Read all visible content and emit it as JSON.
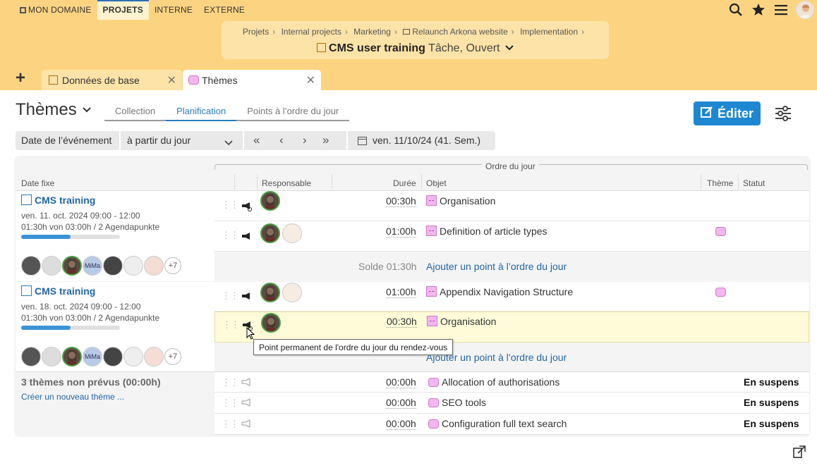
{
  "topnav": {
    "items": [
      "MON DOMAINE",
      "PROJETS",
      "INTERNE",
      "EXTERNE"
    ],
    "active_index": 1
  },
  "breadcrumb": {
    "items": [
      "Projets",
      "Internal projects",
      "Marketing",
      "Relaunch Arkona website",
      "Implementation"
    ],
    "title": "CMS user training",
    "subtitle": "Tâche, Ouvert"
  },
  "tabs": {
    "items": [
      "Données de base",
      "Thèmes"
    ],
    "active_index": 1
  },
  "section": {
    "title": "Thèmes",
    "subtabs": [
      "Collection",
      "Planification",
      "Points à l’ordre du jour"
    ],
    "active_subtab": 1,
    "edit_label": "Éditer"
  },
  "filter": {
    "date_label": "Date de l’événement",
    "range_value": "à partir du jour",
    "date_value": "ven. 11/10/24 (41. Sem.)"
  },
  "table": {
    "group_header": "Ordre du jour",
    "columns": {
      "date": "Date fixe",
      "responsible": "Responsable",
      "duration": "Durée",
      "object": "Objet",
      "theme": "Thème",
      "status": "Statut"
    },
    "meetings": [
      {
        "title": "CMS training",
        "datetime": "ven. 11. oct. 2024 09:00 - 12:00",
        "summary": "01:30h von 03:00h / 2 Agendapunkte",
        "progress": 0.5,
        "participants_more": "+7",
        "balance": "Solde 01:30h",
        "add_link": "Ajouter un point à l’ordre du jour",
        "items": [
          {
            "duration": "00:30h",
            "object": "Organisation",
            "theme": false
          },
          {
            "duration": "01:00h",
            "object": "Definition of article types",
            "theme": true
          }
        ]
      },
      {
        "title": "CMS training",
        "datetime": "ven. 18. oct. 2024 09:00 - 12:00",
        "summary": "01:30h von 03:00h / 2 Agendapunkte",
        "progress": 0.5,
        "participants_more": "+7",
        "add_link": "Ajouter un point à l’ordre du jour",
        "items": [
          {
            "duration": "01:00h",
            "object": "Appendix Navigation Structure",
            "theme": true
          },
          {
            "duration": "00:30h",
            "object": "Organisation",
            "theme": false
          }
        ]
      }
    ],
    "unplanned": {
      "title": "3 thèmes non prévus (00:00h)",
      "create_link": "Créer un nouveau thème ...",
      "items": [
        {
          "duration": "00:00h",
          "object": "Allocation of authorisations",
          "status": "En suspens"
        },
        {
          "duration": "00:00h",
          "object": "SEO tools",
          "status": "En suspens"
        },
        {
          "duration": "00:00h",
          "object": "Configuration full text search",
          "status": "En suspens"
        }
      ]
    }
  },
  "tooltip": "Point permanent de l'ordre du jour du rendez-vous",
  "avatar_initials": "MiMa",
  "colors": {
    "accent": "#1e87d1",
    "header_bg": "#fcd481",
    "highlight_row": "#fffbd9",
    "progress": "#3a93d8"
  }
}
